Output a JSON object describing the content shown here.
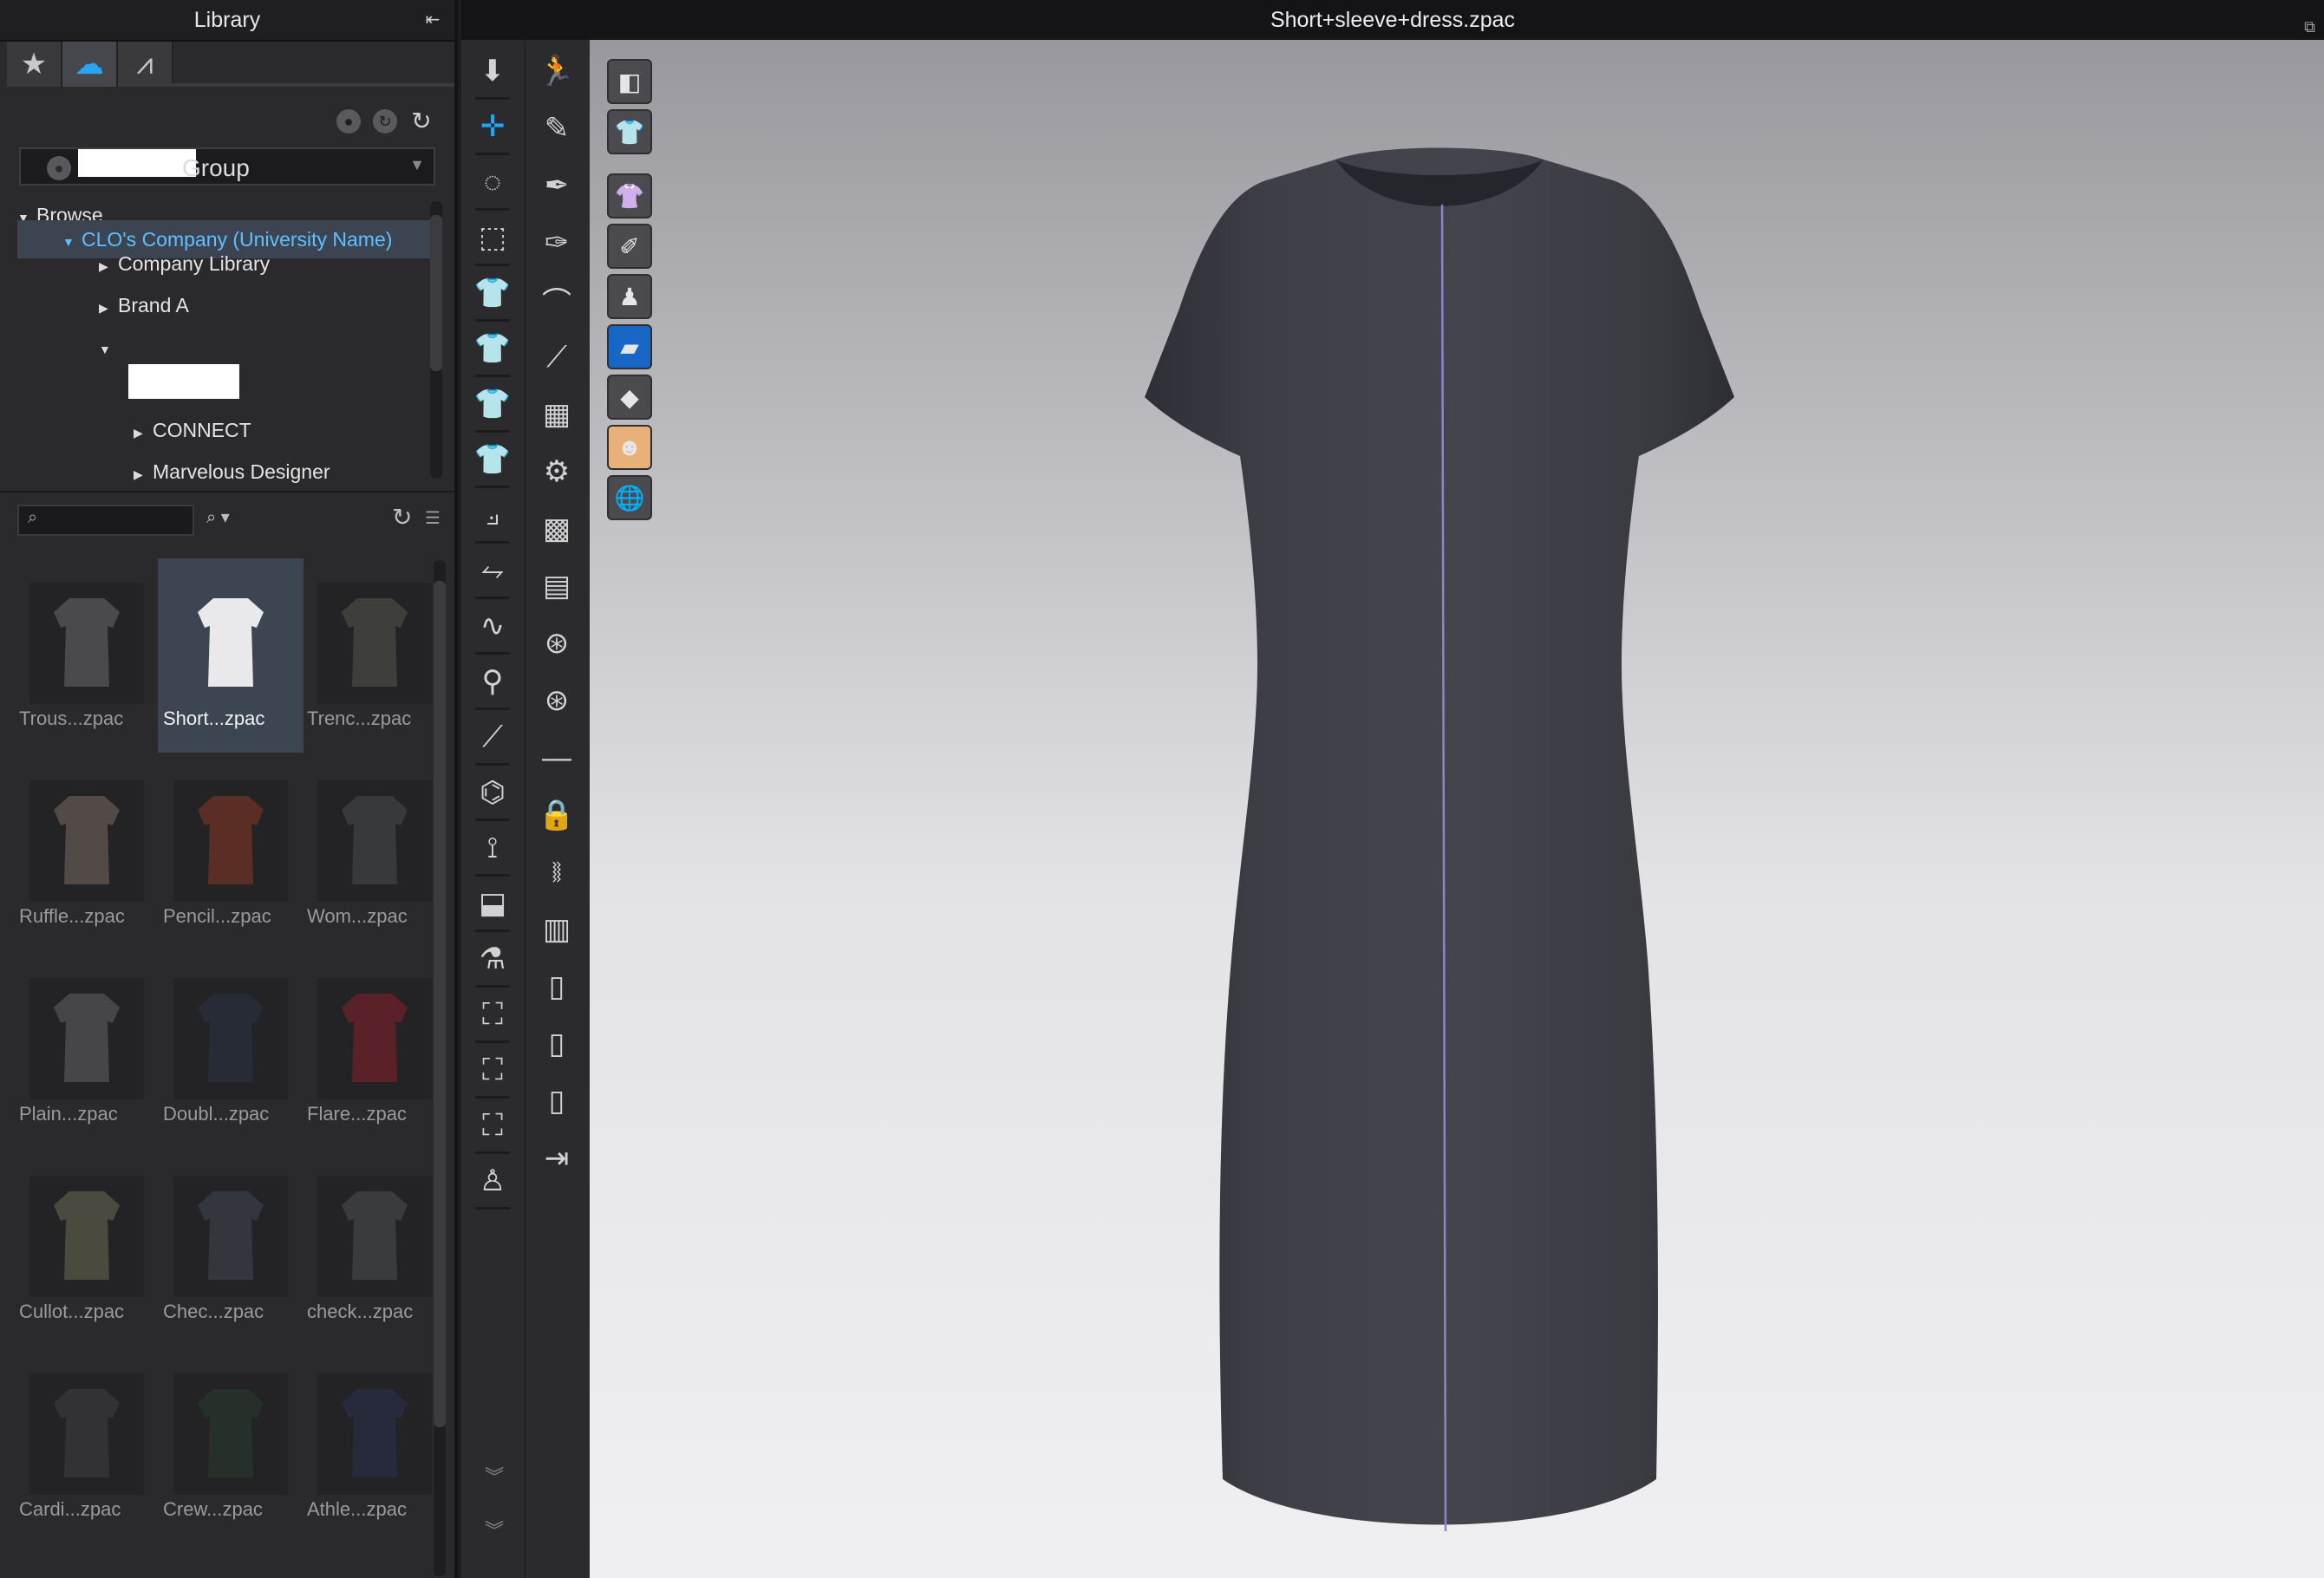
{
  "window": {
    "document_title": "Short+sleeve+dress.zpac"
  },
  "library": {
    "title": "Library",
    "tabs": [
      {
        "icon": "star-icon",
        "glyph": "★"
      },
      {
        "icon": "cloud-icon",
        "glyph": "☁"
      },
      {
        "icon": "clo-logo-icon",
        "glyph": "⩘"
      }
    ],
    "group_label": "Group",
    "tree": [
      {
        "label": "Browse",
        "expanded": true
      },
      {
        "label": "CLO's Company (University Name)",
        "expanded": true,
        "selected": true
      },
      {
        "label": "Company Library",
        "expanded": false
      },
      {
        "label": "Brand A",
        "expanded": false
      },
      {
        "label": "",
        "expanded": true
      },
      {
        "label": "CONNECT",
        "expanded": false
      },
      {
        "label": "Marvelous Designer",
        "expanded": false
      }
    ],
    "search": {
      "placeholder": "",
      "value": ""
    },
    "items": [
      {
        "label": "Trous...zpac",
        "color": "#4a4a4c"
      },
      {
        "label": "Short...zpac",
        "color": "#e9e9eb",
        "selected": true
      },
      {
        "label": "Trenc...zpac",
        "color": "#3e3f3b"
      },
      {
        "label": "Ruffle...zpac",
        "color": "#514a46"
      },
      {
        "label": "Pencil...zpac",
        "color": "#5a2e24"
      },
      {
        "label": "Wom...zpac",
        "color": "#38393c"
      },
      {
        "label": "Plain...zpac",
        "color": "#46464a"
      },
      {
        "label": "Doubl...zpac",
        "color": "#272b35"
      },
      {
        "label": "Flare...zpac",
        "color": "#5a2128"
      },
      {
        "label": "Cullot...zpac",
        "color": "#4a4a3e"
      },
      {
        "label": "Chec...zpac",
        "color": "#33363c"
      },
      {
        "label": "check...zpac",
        "color": "#3a3b3e"
      },
      {
        "label": "Cardi...zpac",
        "color": "#323236"
      },
      {
        "label": "Crew...zpac",
        "color": "#26302a"
      },
      {
        "label": "Athle...zpac",
        "color": "#262a3a"
      }
    ]
  },
  "toolbar": {
    "left_column": [
      "move-down-icon",
      "transform-icon",
      "lasso-select-icon",
      "box-select-icon",
      "garment-tool-icon",
      "garment-tool-icon",
      "garment-tool-icon",
      "garment-tool-icon",
      "sewing-icon",
      "segment-sewing-icon",
      "free-sewing-icon",
      "tack-icon",
      "pin-icon",
      "iron-icon",
      "fold-icon",
      "arrange-icon",
      "layer-icon",
      "avatar-part-icon",
      "avatar-part-icon",
      "avatar-part-icon",
      "avatar-icon"
    ],
    "right_column": [
      "walk-icon",
      "edit-pattern-icon",
      "edit-curve-icon",
      "edit-point-icon",
      "curve-icon",
      "line-tool-icon",
      "texture-icon",
      "stitch-icon",
      "graphic-icon",
      "texture-edit-icon",
      "button-icon",
      "button-icon",
      "line-icon",
      "lock-icon",
      "zipper-icon",
      "tape-icon",
      "fabric-icon",
      "fabric-icon",
      "fabric-icon",
      "strength-icon"
    ]
  },
  "viewport": {
    "tools": [
      "avatar-display-icon",
      "garment-display-icon",
      "shirt-view-icon",
      "edit-pattern-view-icon",
      "avatar-view-icon",
      "fabric-view-icon",
      "surface-icon",
      "skin-icon",
      "globe-icon"
    ],
    "garment_color": "#3f4047",
    "seam_color": "#8a86c9"
  }
}
